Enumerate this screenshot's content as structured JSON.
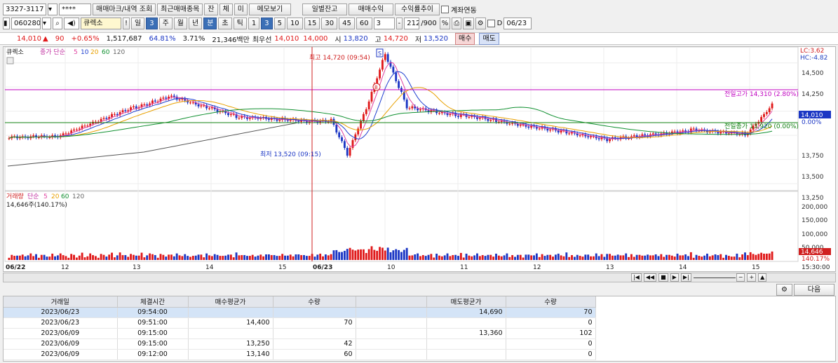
{
  "toolbar1": {
    "account": "3327-3117",
    "password": "****",
    "btn_trade_mark": "매매마크/내역 조회",
    "btn_recent": "최근매매종목",
    "btn_jan": "잔",
    "btn_che": "체",
    "btn_mi": "미",
    "btn_memo": "메모보기",
    "btn_daily": "일별잔고",
    "btn_return": "매매수익",
    "btn_yield": "수익률추이",
    "link_account": "계좌연동"
  },
  "toolbar2": {
    "code": "060280",
    "name": "큐렉소",
    "periods": [
      "일",
      "3",
      "주",
      "월",
      "년",
      "분",
      "초",
      "틱",
      "1",
      "3",
      "5",
      "10",
      "15",
      "30",
      "45",
      "60"
    ],
    "selected_periods": [
      "3",
      "분",
      "3"
    ],
    "count_value": "3",
    "view_count": "212",
    "view_total": "/900",
    "flag_d": "D",
    "date": "06/23"
  },
  "quote": {
    "price": "14,010",
    "arrow": "▲",
    "change": "90",
    "rate": "+0.65%",
    "volume": "1,517,687",
    "strength": "64.81%",
    "turnover": "3.71%",
    "amount": "21,346백만",
    "best_label": "최우선",
    "best_ask": "14,010",
    "best_bid": "14,000",
    "open_label": "시",
    "open": "13,820",
    "high_label": "고",
    "high": "14,720",
    "low_label": "저",
    "low": "13,520",
    "buy_btn": "매수",
    "sell_btn": "매도"
  },
  "price_panel": {
    "legend_name": "큐렉소",
    "ma_label": "종가 단순",
    "ma_periods": [
      "5",
      "10",
      "20",
      "60",
      "120"
    ],
    "ma_colors": [
      "#e040a0",
      "#2040d0",
      "#e8a000",
      "#109030",
      "#555555"
    ],
    "lc": "LC:3.62",
    "hc": "HC:-4.82",
    "yticks": [
      "14,500",
      "14,250",
      "14,000",
      "13,750",
      "13,500",
      "13,250"
    ],
    "cur_price_tag": "14,010",
    "cur_rate_tag": "0.00%",
    "high_marker": "최고 14,720 (09:54)",
    "low_marker": "최저 13,520 (09:15)",
    "prev_high_label": "전일고가 14,310 (2.80%)",
    "prev_close_label": "전일종가 13,920 (0.00%)",
    "trade_mark_sell": "S",
    "trade_mark_buy": "B"
  },
  "volume_panel": {
    "legend_name": "거래량",
    "ma_label": "단순",
    "ma_periods": [
      "5",
      "20",
      "60",
      "120"
    ],
    "cur_text": "14,646주(140.17%)",
    "yticks": [
      "200,000",
      "150,000",
      "100,000",
      "50,000"
    ],
    "cur_tag": "14,646",
    "cur_pct_tag": "140.17%"
  },
  "xaxis": [
    "06/22",
    "12",
    "13",
    "14",
    "15",
    "06/23",
    "10",
    "11",
    "12",
    "13",
    "14",
    "15",
    "15:30:00"
  ],
  "bottom": {
    "next_btn": "다음"
  },
  "table": {
    "headers": [
      "거래일",
      "체결시간",
      "매수평균가",
      "수량",
      "",
      "매도평균가",
      "수량"
    ],
    "rows": [
      [
        "2023/06/23",
        "09:54:00",
        "",
        "",
        "",
        "14,690",
        "70"
      ],
      [
        "2023/06/23",
        "09:51:00",
        "14,400",
        "70",
        "",
        "",
        "0"
      ],
      [
        "2023/06/09",
        "09:15:00",
        "",
        "",
        "",
        "13,360",
        "102"
      ],
      [
        "2023/06/09",
        "09:15:00",
        "13,250",
        "42",
        "",
        "",
        "0"
      ],
      [
        "2023/06/09",
        "09:12:00",
        "13,140",
        "60",
        "",
        "",
        "0"
      ]
    ]
  },
  "colors": {
    "up": "#e0191a",
    "down": "#1b36c4",
    "accent": "#3b6fb6",
    "prev_high": "#c000c0",
    "prev_close": "#108010"
  },
  "chart_data": {
    "type": "candlestick",
    "unit": "KRW",
    "ylim": [
      13200,
      14650
    ],
    "sessions": [
      "06/22",
      "06/23"
    ],
    "prev_high": 14310,
    "prev_close": 13920,
    "day_high": 14720,
    "day_low": 13520,
    "last": 14010,
    "volume_ylim": [
      0,
      230000
    ]
  }
}
